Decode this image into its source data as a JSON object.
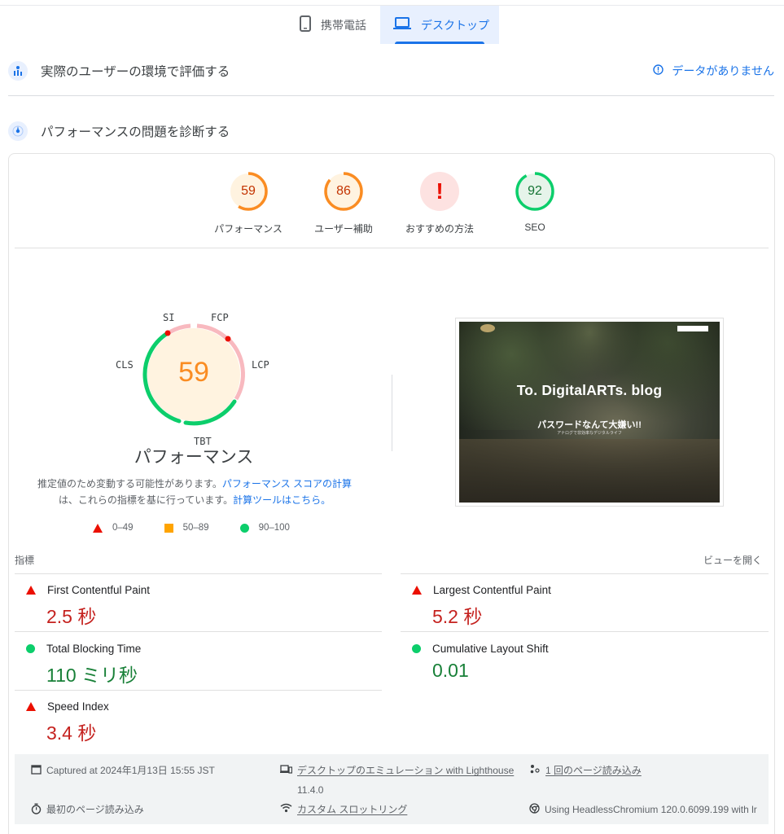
{
  "tabs": {
    "mobile": "携帯電話",
    "desktop": "デスクトップ"
  },
  "field": {
    "title": "実際のユーザーの環境で評価する",
    "status": "データがありません"
  },
  "lab": {
    "title": "パフォーマンスの問題を診断する"
  },
  "scores": [
    {
      "label": "パフォーマンス",
      "value": "59",
      "fraction": 0.59,
      "color": "#fa8c22"
    },
    {
      "label": "ユーザー補助",
      "value": "86",
      "fraction": 0.86,
      "color": "#fa8c22"
    },
    {
      "label": "おすすめの方法",
      "value": "!",
      "fraction": 1,
      "color": "#eb0f00"
    },
    {
      "label": "SEO",
      "value": "92",
      "fraction": 0.92,
      "color": "#0cce6b"
    }
  ],
  "main_gauge": {
    "score": "59",
    "title": "パフォーマンス",
    "labels": {
      "si": "SI",
      "fcp": "FCP",
      "lcp": "LCP",
      "tbt": "TBT",
      "cls": "CLS"
    }
  },
  "note": {
    "text1": "推定値のため変動する可能性があります。",
    "link1": "パフォーマンス スコアの計算",
    "text2": "は、これらの指標を基に行っています。",
    "link2": "計算ツールはこちら。"
  },
  "legend": {
    "fail": "0–49",
    "average": "50–89",
    "pass": "90–100"
  },
  "thumbnail": {
    "title": "To. DigitalARTs. blog",
    "subtitle": "パスワードなんて大嫌い!!",
    "caption": "アナログで非効率なデジタルライフ"
  },
  "metrics_header": {
    "title": "指標",
    "expand": "ビューを開く"
  },
  "metrics": [
    {
      "name": "First Contentful Paint",
      "value": "2.5 秒",
      "status": "fail"
    },
    {
      "name": "Largest Contentful Paint",
      "value": "5.2 秒",
      "status": "fail"
    },
    {
      "name": "Total Blocking Time",
      "value": "110 ミリ秒",
      "status": "pass"
    },
    {
      "name": "Cumulative Layout Shift",
      "value": "0.01",
      "status": "pass"
    },
    {
      "name": "Speed Index",
      "value": "3.4 秒",
      "status": "fail"
    }
  ],
  "footer": {
    "captured": "Captured at 2024年1月13日 15:55 JST",
    "emulation": "デスクトップのエミュレーション with Lighthouse",
    "emulation_version": "11.4.0",
    "session": "1 回のページ読み込み",
    "initial_load": "最初のページ読み込み",
    "throttling": "カスタム スロットリング",
    "browser": "Using HeadlessChromium 120.0.6099.199 with lr"
  }
}
